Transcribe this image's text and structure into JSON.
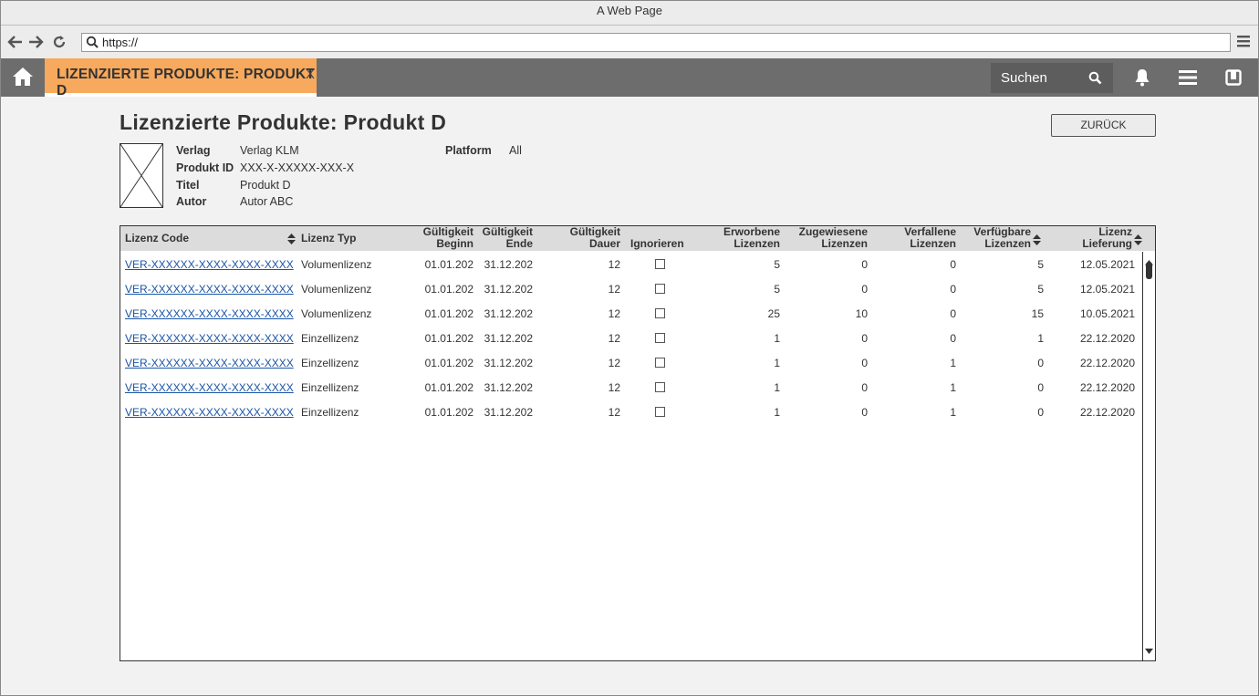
{
  "browser": {
    "window_title": "A Web Page",
    "url": "https://"
  },
  "appbar": {
    "tab_label": "LIZENZIERTE PRODUKTE: PRODUKT D",
    "tab_close": "X",
    "search_placeholder": "Suchen"
  },
  "page": {
    "title": "Lizenzierte Produkte: Produkt D",
    "back_button": "ZURÜCK"
  },
  "product": {
    "verlag_label": "Verlag",
    "verlag": "Verlag KLM",
    "produkt_id_label": "Produkt ID",
    "produkt_id": "XXX-X-XXXXX-XXX-X",
    "titel_label": "Titel",
    "titel": "Produkt D",
    "autor_label": "Autor",
    "autor": "Autor ABC",
    "platform_label": "Platform",
    "platform": "All"
  },
  "table": {
    "headers": {
      "lizenz_code": "Lizenz Code",
      "lizenz_typ": "Lizenz Typ",
      "beginn_1": "Gültigkeit",
      "beginn_2": "Beginn",
      "ende_1": "Gültigkeit",
      "ende_2": "Ende",
      "dauer_1": "Gültigkeit",
      "dauer_2": "Dauer",
      "ignorieren": "Ignorieren",
      "erworbene_1": "Erworbene",
      "erworbene_2": "Lizenzen",
      "zugewiesene_1": "Zugewiesene",
      "zugewiesene_2": "Lizenzen",
      "verfallene_1": "Verfallene",
      "verfallene_2": "Lizenzen",
      "verfuegbare_1": "Verfügbare",
      "verfuegbare_2": "Lizenzen",
      "lieferung_1": "Lizenz",
      "lieferung_2": "Lieferung"
    },
    "rows": [
      {
        "code": "VER-XXXXXX-XXXX-XXXX-XXXX",
        "typ": "Volumenlizenz",
        "beginn": "01.01.202",
        "ende": "31.12.202",
        "dauer": "12",
        "erworbene": "5",
        "zugewiesene": "0",
        "verfallene": "0",
        "verfuegbare": "5",
        "lieferung": "12.05.2021"
      },
      {
        "code": "VER-XXXXXX-XXXX-XXXX-XXXX",
        "typ": "Volumenlizenz",
        "beginn": "01.01.202",
        "ende": "31.12.202",
        "dauer": "12",
        "erworbene": "5",
        "zugewiesene": "0",
        "verfallene": "0",
        "verfuegbare": "5",
        "lieferung": "12.05.2021"
      },
      {
        "code": "VER-XXXXXX-XXXX-XXXX-XXXX",
        "typ": "Volumenlizenz",
        "beginn": "01.01.202",
        "ende": "31.12.202",
        "dauer": "12",
        "erworbene": "25",
        "zugewiesene": "10",
        "verfallene": "0",
        "verfuegbare": "15",
        "lieferung": "10.05.2021"
      },
      {
        "code": "VER-XXXXXX-XXXX-XXXX-XXXX",
        "typ": "Einzellizenz",
        "beginn": "01.01.202",
        "ende": "31.12.202",
        "dauer": "12",
        "erworbene": "1",
        "zugewiesene": "0",
        "verfallene": "0",
        "verfuegbare": "1",
        "lieferung": "22.12.2020"
      },
      {
        "code": "VER-XXXXXX-XXXX-XXXX-XXXX",
        "typ": "Einzellizenz",
        "beginn": "01.01.202",
        "ende": "31.12.202",
        "dauer": "12",
        "erworbene": "1",
        "zugewiesene": "0",
        "verfallene": "1",
        "verfuegbare": "0",
        "lieferung": "22.12.2020"
      },
      {
        "code": "VER-XXXXXX-XXXX-XXXX-XXXX",
        "typ": "Einzellizenz",
        "beginn": "01.01.202",
        "ende": "31.12.202",
        "dauer": "12",
        "erworbene": "1",
        "zugewiesene": "0",
        "verfallene": "1",
        "verfuegbare": "0",
        "lieferung": "22.12.2020"
      },
      {
        "code": "VER-XXXXXX-XXXX-XXXX-XXXX",
        "typ": "Einzellizenz",
        "beginn": "01.01.202",
        "ende": "31.12.202",
        "dauer": "12",
        "erworbene": "1",
        "zugewiesene": "0",
        "verfallene": "1",
        "verfuegbare": "0",
        "lieferung": "22.12.2020"
      }
    ]
  }
}
